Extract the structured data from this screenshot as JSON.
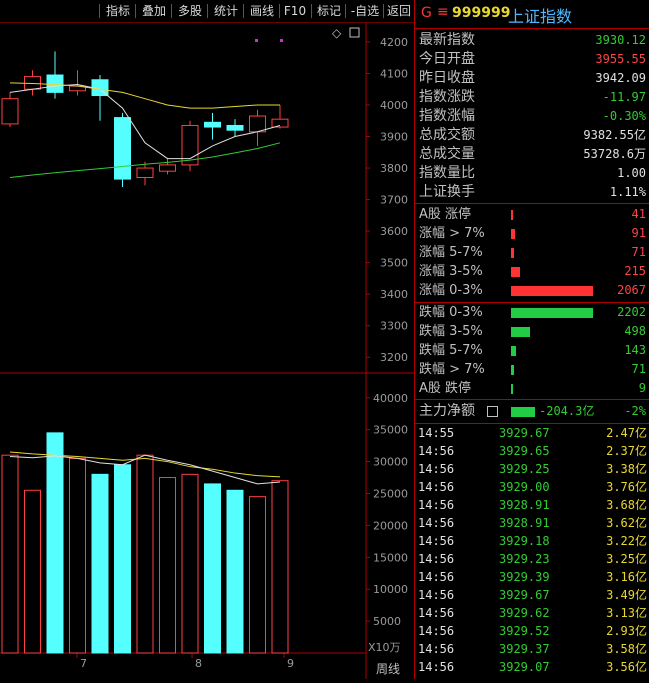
{
  "toolbar": {
    "buttons": [
      "指标",
      "叠加",
      "多股",
      "统计",
      "画线",
      "F10",
      "标记",
      "-自选",
      "返回"
    ]
  },
  "price_axis": [
    "4200",
    "4100",
    "4000",
    "3900",
    "3800",
    "3700",
    "3600",
    "3500",
    "3400",
    "3300",
    "3200"
  ],
  "volume_axis": [
    "40000",
    "35000",
    "30000",
    "25000",
    "20000",
    "15000",
    "10000",
    "5000"
  ],
  "volume_unit": "X10万",
  "period_label": "周线",
  "date_ticks": [
    "7",
    "8",
    "9"
  ],
  "header": {
    "flag": "G",
    "menu_glyph": "≡",
    "code": "999999",
    "name": "上证指数"
  },
  "stats": [
    {
      "label": "最新指数",
      "value": "3930.12",
      "color": "#33cc33"
    },
    {
      "label": "今日开盘",
      "value": "3955.55",
      "color": "#ff4444"
    },
    {
      "label": "昨日收盘",
      "value": "3942.09",
      "color": "#e0e0e0"
    },
    {
      "label": "指数涨跌",
      "value": "-11.97",
      "color": "#33cc33"
    },
    {
      "label": "指数涨幅",
      "value": "-0.30%",
      "color": "#33cc33"
    },
    {
      "label": "总成交额",
      "value": "9382.55亿",
      "color": "#e0e0e0"
    },
    {
      "label": "总成交量",
      "value": "53728.6万",
      "color": "#e0e0e0"
    },
    {
      "label": "指数量比",
      "value": "1.00",
      "color": "#e0e0e0"
    },
    {
      "label": "上证换手",
      "value": "1.11%",
      "color": "#e0e0e0"
    }
  ],
  "breadth_up": [
    {
      "label": "A股 涨停",
      "value": "41",
      "ratio": 0.01
    },
    {
      "label": "涨幅 > 7%",
      "value": "91",
      "ratio": 0.044
    },
    {
      "label": "涨幅 5-7%",
      "value": "71",
      "ratio": 0.034
    },
    {
      "label": "涨幅 3-5%",
      "value": "215",
      "ratio": 0.104
    },
    {
      "label": "涨幅 0-3%",
      "value": "2067",
      "ratio": 1.0
    }
  ],
  "breadth_down": [
    {
      "label": "跌幅 0-3%",
      "value": "2202",
      "ratio": 1.0
    },
    {
      "label": "跌幅 3-5%",
      "value": "498",
      "ratio": 0.226
    },
    {
      "label": "跌幅 5-7%",
      "value": "143",
      "ratio": 0.065
    },
    {
      "label": "跌幅 > 7%",
      "value": "71",
      "ratio": 0.032
    },
    {
      "label": "A股 跌停",
      "value": "9",
      "ratio": 0.004
    }
  ],
  "main_flow": {
    "label": "主力净额",
    "value": "-204.3亿",
    "pct": "-2%"
  },
  "ticks": [
    {
      "time": "14:55",
      "price": "3929.67",
      "vol": "2.47亿"
    },
    {
      "time": "14:56",
      "price": "3929.65",
      "vol": "2.37亿"
    },
    {
      "time": "14:56",
      "price": "3929.25",
      "vol": "3.38亿"
    },
    {
      "time": "14:56",
      "price": "3929.00",
      "vol": "3.76亿"
    },
    {
      "time": "14:56",
      "price": "3928.91",
      "vol": "3.68亿"
    },
    {
      "time": "14:56",
      "price": "3928.91",
      "vol": "3.62亿"
    },
    {
      "time": "14:56",
      "price": "3929.18",
      "vol": "3.22亿"
    },
    {
      "time": "14:56",
      "price": "3929.23",
      "vol": "3.25亿"
    },
    {
      "time": "14:56",
      "price": "3929.39",
      "vol": "3.16亿"
    },
    {
      "time": "14:56",
      "price": "3929.67",
      "vol": "3.49亿"
    },
    {
      "time": "14:56",
      "price": "3929.62",
      "vol": "3.13亿"
    },
    {
      "time": "14:56",
      "price": "3929.52",
      "vol": "2.93亿"
    },
    {
      "time": "14:56",
      "price": "3929.37",
      "vol": "3.58亿"
    },
    {
      "time": "14:56",
      "price": "3929.07",
      "vol": "3.56亿"
    }
  ],
  "chart_data": {
    "type": "candlestick",
    "price_range": [
      3150,
      4260
    ],
    "volume_range": [
      0,
      42000
    ],
    "candles": [
      {
        "o": 3940,
        "c": 4020,
        "h": 4040,
        "l": 3930,
        "up": true
      },
      {
        "o": 4050,
        "c": 4090,
        "h": 4110,
        "l": 4030,
        "up": true
      },
      {
        "o": 4095,
        "c": 4040,
        "h": 4170,
        "l": 4020,
        "up": false
      },
      {
        "o": 4060,
        "c": 4045,
        "h": 4110,
        "l": 4030,
        "up": true
      },
      {
        "o": 4080,
        "c": 4030,
        "h": 4095,
        "l": 3950,
        "up": false
      },
      {
        "o": 3960,
        "c": 3765,
        "h": 3975,
        "l": 3740,
        "up": false
      },
      {
        "o": 3770,
        "c": 3800,
        "h": 3820,
        "l": 3745,
        "up": true
      },
      {
        "o": 3790,
        "c": 3810,
        "h": 3830,
        "l": 3780,
        "up": true
      },
      {
        "o": 3810,
        "c": 3935,
        "h": 3950,
        "l": 3790,
        "up": true
      },
      {
        "o": 3945,
        "c": 3930,
        "h": 3975,
        "l": 3890,
        "up": false
      },
      {
        "o": 3935,
        "c": 3920,
        "h": 3955,
        "l": 3900,
        "up": false
      },
      {
        "o": 3915,
        "c": 3965,
        "h": 3985,
        "l": 3870,
        "up": true
      },
      {
        "o": 3955,
        "c": 3930,
        "h": 4000,
        "l": 3925,
        "up": true
      }
    ],
    "volumes": [
      {
        "v": 31000,
        "up": true
      },
      {
        "v": 25500,
        "up": true
      },
      {
        "v": 34500,
        "up": false
      },
      {
        "v": 30500,
        "up": true
      },
      {
        "v": 28000,
        "up": false
      },
      {
        "v": 29500,
        "up": false
      },
      {
        "v": 31000,
        "up": true
      },
      {
        "v": 27500,
        "up": true
      },
      {
        "v": 28000,
        "up": true
      },
      {
        "v": 26500,
        "up": false
      },
      {
        "v": 25500,
        "up": false
      },
      {
        "v": 24500,
        "up": true
      },
      {
        "v": 27000,
        "up": true
      }
    ],
    "ma_lines": [
      {
        "color": "#e0e0e0",
        "values": [
          4040,
          4050,
          4060,
          4065,
          4050,
          3990,
          3880,
          3830,
          3830,
          3870,
          3900,
          3915,
          3935
        ]
      },
      {
        "color": "#e8d830",
        "values": [
          4070,
          4068,
          4065,
          4060,
          4050,
          4040,
          4020,
          4000,
          3990,
          3990,
          3995,
          4000,
          4000
        ]
      },
      {
        "color": "#33cc33",
        "values": [
          3770,
          3778,
          3785,
          3792,
          3798,
          3805,
          3812,
          3818,
          3825,
          3835,
          3848,
          3862,
          3880
        ]
      }
    ],
    "vol_ma_lines": [
      {
        "color": "#e8d830",
        "values": [
          31500,
          31200,
          31000,
          30800,
          30500,
          30200,
          30500,
          30000,
          29200,
          28800,
          28200,
          27800,
          27600
        ]
      },
      {
        "color": "#e0e0e0",
        "values": [
          30800,
          30600,
          30900,
          30500,
          29800,
          29500,
          31000,
          30200,
          29500,
          28500,
          27500,
          26500,
          26800
        ]
      }
    ]
  }
}
